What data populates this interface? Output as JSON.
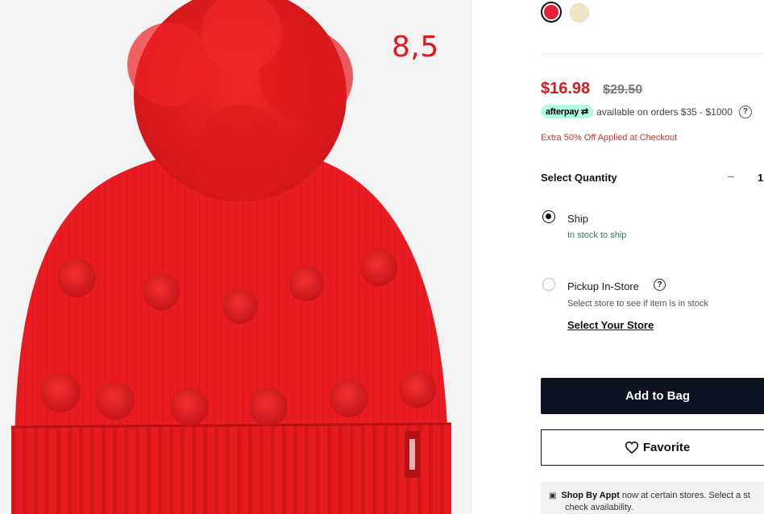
{
  "overlay": {
    "number": "8,5"
  },
  "swatches": [
    {
      "name": "red",
      "color": "#e81f3a",
      "selected": true
    },
    {
      "name": "cream",
      "color": "#f1e5c7",
      "selected": false
    }
  ],
  "price": {
    "sale": "$16.98",
    "original": "$29.50"
  },
  "afterpay": {
    "badge": "afterpay",
    "text": "available on orders $35 - $1000",
    "help": "?"
  },
  "promo": "Extra 50% Off Applied at Checkout",
  "quantity": {
    "label": "Select Quantity",
    "minus": "–",
    "value": "1"
  },
  "fulfillment": {
    "ship": {
      "label": "Ship",
      "status": "In stock to ship",
      "selected": true
    },
    "pickup": {
      "label": "Pickup In-Store",
      "help": "?",
      "note": "Select store to see if item is in stock",
      "link": "Select Your Store",
      "selected": false
    }
  },
  "buttons": {
    "add_to_bag": "Add to Bag",
    "favorite": "Favorite"
  },
  "appointment": {
    "bold": "Shop By Appt",
    "text": "now at certain stores. Select a st",
    "line2": "check availability."
  },
  "colors": {
    "accent_dark": "#0d1321",
    "sale_red": "#d71920",
    "hat_red": "#e81f25"
  }
}
